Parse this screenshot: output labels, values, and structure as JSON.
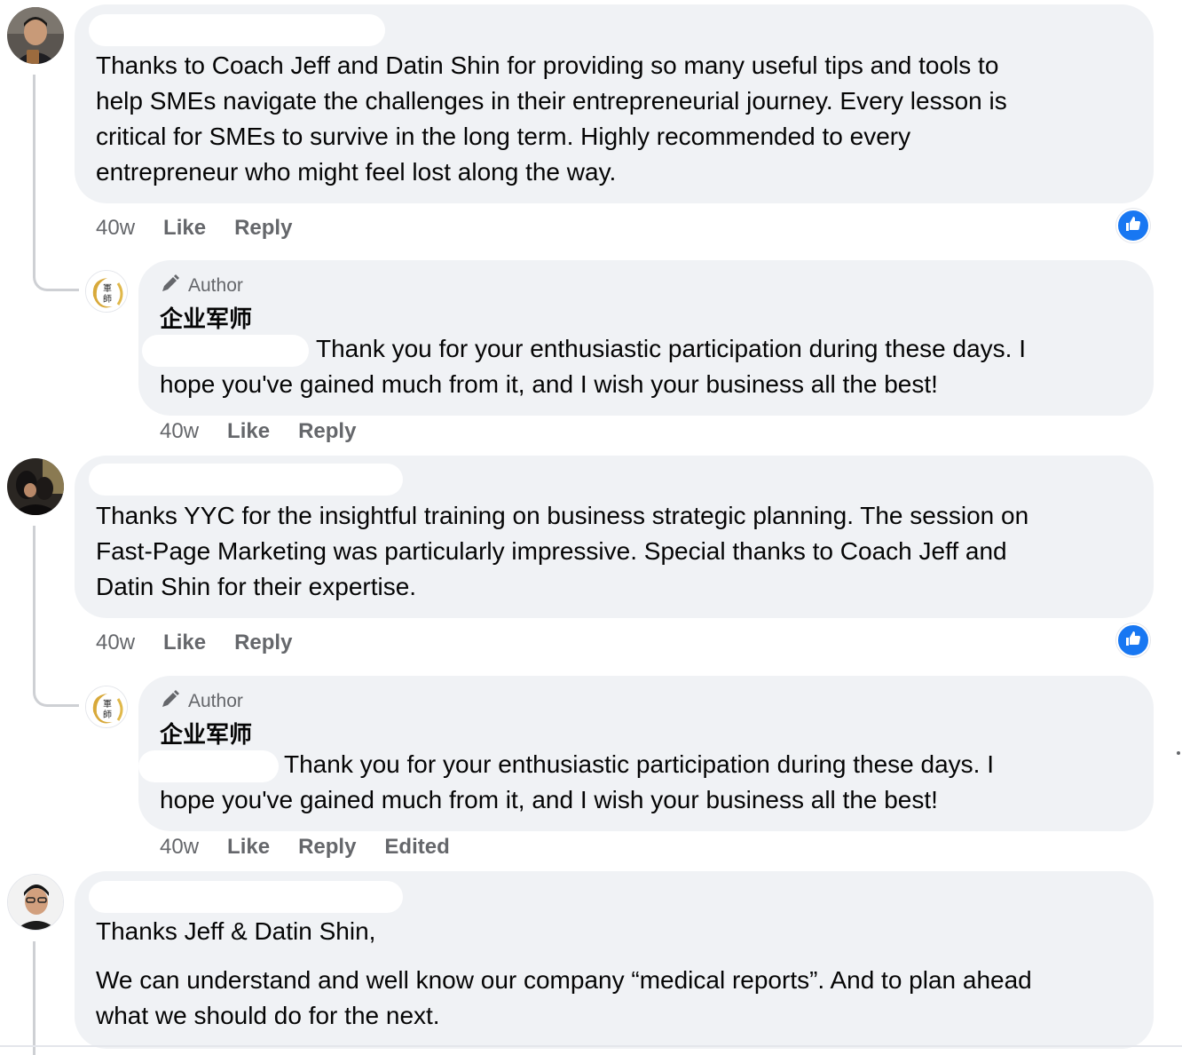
{
  "comments": [
    {
      "text": "Thanks to Coach Jeff and Datin Shin for providing so many useful tips and tools to help SMEs navigate the challenges in their entrepreneurial journey. Every lesson is critical for SMEs to survive in the long term. Highly recommended to every entrepreneur who might feel lost along the way.",
      "lines": [
        "Thanks to Coach Jeff and Datin Shin for providing so many useful tips and tools to",
        "help SMEs navigate the challenges in their entrepreneurial journey. Every lesson is",
        "critical for SMEs to survive in the long term. Highly recommended to every",
        "entrepreneur who might feel lost along the way."
      ],
      "time": "40w",
      "like": "Like",
      "reply": "Reply",
      "reaction_icon": "thumbs-up-icon",
      "author_reply": {
        "badge": "Author",
        "badge_icon": "pencil-icon",
        "name": "企业军师",
        "lines": [
          "Thank you for your enthusiastic participation during these days. I",
          "hope you've gained much from it, and I wish your business all the best!"
        ],
        "time": "40w",
        "like": "Like",
        "reply": "Reply"
      }
    },
    {
      "lines": [
        "Thanks YYC for the insightful training on business strategic planning. The session on",
        "Fast-Page Marketing was particularly impressive. Special thanks to Coach Jeff and",
        "Datin Shin for their expertise."
      ],
      "time": "40w",
      "like": "Like",
      "reply": "Reply",
      "reaction_icon": "thumbs-up-icon",
      "author_reply": {
        "badge": "Author",
        "badge_icon": "pencil-icon",
        "name": "企业军师",
        "lines": [
          "Thank you for your enthusiastic participation during these days. I",
          "hope you've gained much from it, and I wish your business all the best!"
        ],
        "time": "40w",
        "like": "Like",
        "reply": "Reply",
        "edited": "Edited"
      }
    },
    {
      "lines": [
        "Thanks Jeff & Datin Shin,",
        "We can understand and well know our company “medical reports”. And to plan ahead",
        "what we should do for the next."
      ]
    }
  ],
  "colors": {
    "bubble": "#f0f2f5",
    "meta_text": "#65676b",
    "like_blue": "#1877f2",
    "thread_line": "#ced0d4"
  }
}
